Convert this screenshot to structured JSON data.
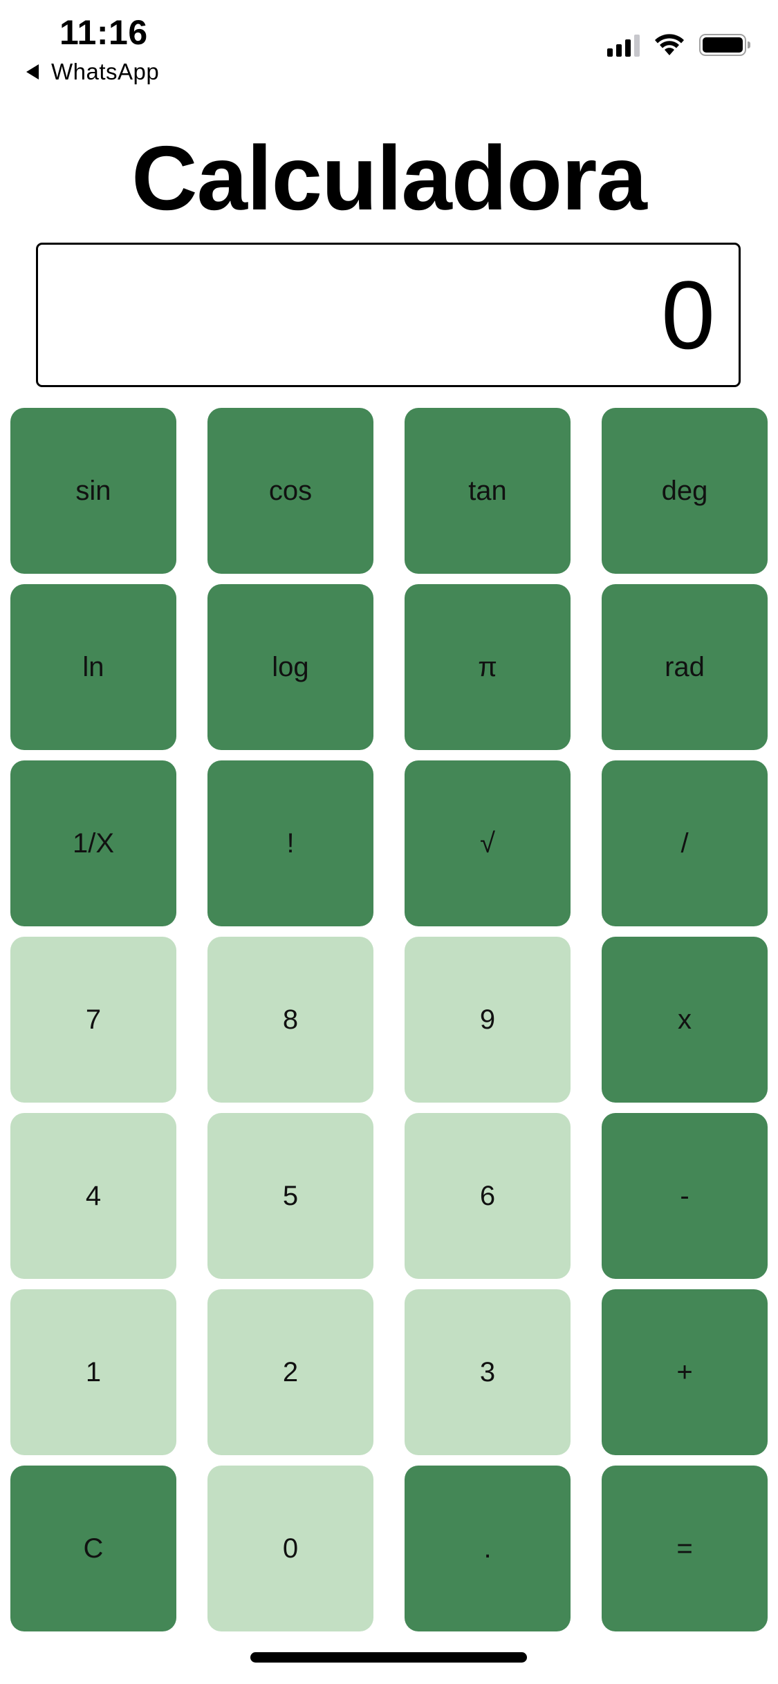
{
  "status_bar": {
    "time": "11:16",
    "back_label": "WhatsApp",
    "icons": [
      "cellular-signal-icon",
      "wifi-icon",
      "battery-icon"
    ]
  },
  "app": {
    "title": "Calculadora",
    "display_value": "0"
  },
  "colors": {
    "function_key": "#448756",
    "digit_key": "#c3dfc3",
    "text": "#000000"
  },
  "keys": [
    {
      "label": "sin",
      "type": "dark",
      "name": "sin-key"
    },
    {
      "label": "cos",
      "type": "dark",
      "name": "cos-key"
    },
    {
      "label": "tan",
      "type": "dark",
      "name": "tan-key"
    },
    {
      "label": "deg",
      "type": "dark",
      "name": "deg-key"
    },
    {
      "label": "ln",
      "type": "dark",
      "name": "ln-key"
    },
    {
      "label": "log",
      "type": "dark",
      "name": "log-key"
    },
    {
      "label": "π",
      "type": "dark",
      "name": "pi-key"
    },
    {
      "label": "rad",
      "type": "dark",
      "name": "rad-key"
    },
    {
      "label": "1/X",
      "type": "dark",
      "name": "reciprocal-key"
    },
    {
      "label": "!",
      "type": "dark",
      "name": "factorial-key"
    },
    {
      "label": "√",
      "type": "dark",
      "name": "sqrt-key"
    },
    {
      "label": "/",
      "type": "dark",
      "name": "divide-key"
    },
    {
      "label": "7",
      "type": "light",
      "name": "digit-7-key"
    },
    {
      "label": "8",
      "type": "light",
      "name": "digit-8-key"
    },
    {
      "label": "9",
      "type": "light",
      "name": "digit-9-key"
    },
    {
      "label": "x",
      "type": "dark",
      "name": "multiply-key"
    },
    {
      "label": "4",
      "type": "light",
      "name": "digit-4-key"
    },
    {
      "label": "5",
      "type": "light",
      "name": "digit-5-key"
    },
    {
      "label": "6",
      "type": "light",
      "name": "digit-6-key"
    },
    {
      "label": "-",
      "type": "dark",
      "name": "subtract-key"
    },
    {
      "label": "1",
      "type": "light",
      "name": "digit-1-key"
    },
    {
      "label": "2",
      "type": "light",
      "name": "digit-2-key"
    },
    {
      "label": "3",
      "type": "light",
      "name": "digit-3-key"
    },
    {
      "label": "+",
      "type": "dark",
      "name": "add-key"
    },
    {
      "label": "C",
      "type": "dark",
      "name": "clear-key"
    },
    {
      "label": "0",
      "type": "light",
      "name": "digit-0-key"
    },
    {
      "label": ".",
      "type": "dark",
      "name": "decimal-key"
    },
    {
      "label": "=",
      "type": "dark",
      "name": "equals-key"
    }
  ]
}
